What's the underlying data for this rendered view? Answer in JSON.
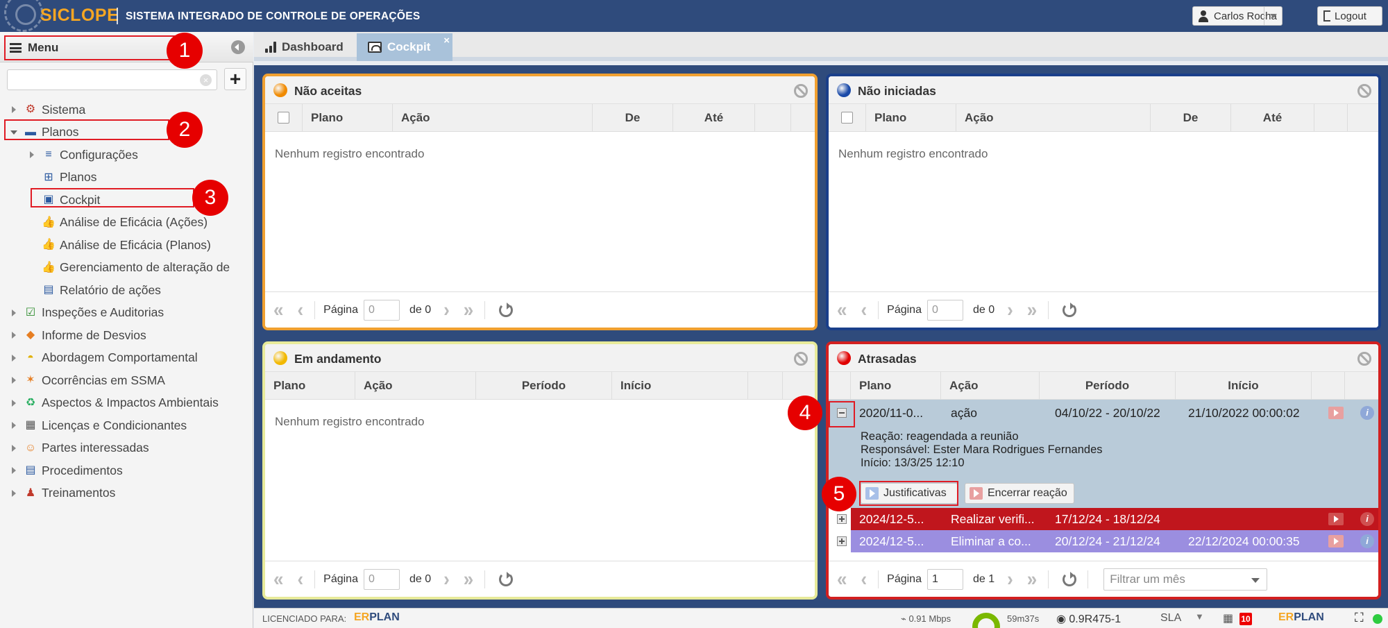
{
  "app": {
    "logo": "SICLOPE",
    "subtitle": "SISTEMA INTEGRADO DE CONTROLE DE OPERAÇÕES",
    "user_name": "Carlos Rocha",
    "logout_label": "Logout"
  },
  "sidebar": {
    "menu_title": "Menu",
    "search": {
      "value": "",
      "placeholder": ""
    },
    "add_label": "+",
    "items": [
      {
        "label": "Sistema",
        "icon": "gear-icon",
        "level": 0,
        "state": "closed"
      },
      {
        "label": "Planos",
        "icon": "folder-icon",
        "level": 0,
        "state": "open"
      },
      {
        "label": "Configurações",
        "icon": "sliders-icon",
        "level": 1,
        "state": "closed"
      },
      {
        "label": "Planos",
        "icon": "map-icon",
        "level": 1,
        "state": "leaf"
      },
      {
        "label": "Cockpit",
        "icon": "dashboard-icon",
        "level": 1,
        "state": "leaf"
      },
      {
        "label": "Análise de Eficácia (Ações)",
        "icon": "thumbs-up-icon",
        "level": 1,
        "state": "leaf"
      },
      {
        "label": "Análise de Eficácia (Planos)",
        "icon": "thumbs-up-icon",
        "level": 1,
        "state": "leaf"
      },
      {
        "label": "Gerenciamento de alteração de",
        "icon": "thumbs-up-icon",
        "level": 1,
        "state": "leaf"
      },
      {
        "label": "Relatório de ações",
        "icon": "pdf-icon",
        "level": 1,
        "state": "leaf"
      },
      {
        "label": "Inspeções e Auditorias",
        "icon": "clipboard-check-icon",
        "level": 0,
        "state": "closed"
      },
      {
        "label": "Informe de Desvios",
        "icon": "warning-diamond-icon",
        "level": 0,
        "state": "closed"
      },
      {
        "label": "Abordagem Comportamental",
        "icon": "helmet-icon",
        "level": 0,
        "state": "closed"
      },
      {
        "label": "Ocorrências em SSMA",
        "icon": "person-falling-icon",
        "level": 0,
        "state": "closed"
      },
      {
        "label": "Aspectos & Impactos Ambientais",
        "icon": "recycle-icon",
        "level": 0,
        "state": "closed"
      },
      {
        "label": "Licenças e Condicionantes",
        "icon": "license-icon",
        "level": 0,
        "state": "closed"
      },
      {
        "label": "Partes interessadas",
        "icon": "people-icon",
        "level": 0,
        "state": "closed"
      },
      {
        "label": "Procedimentos",
        "icon": "document-list-icon",
        "level": 0,
        "state": "closed"
      },
      {
        "label": "Treinamentos",
        "icon": "trainer-icon",
        "level": 0,
        "state": "closed"
      }
    ]
  },
  "tabs": [
    {
      "label": "Dashboard",
      "icon": "bar-chart-icon",
      "active": false
    },
    {
      "label": "Cockpit",
      "icon": "dashboard-icon",
      "active": true,
      "close": "×"
    }
  ],
  "panels": {
    "nao_aceitas": {
      "title": "Não aceitas",
      "dot_color": "#f08a00",
      "columns": [
        "Plano",
        "Ação",
        "De",
        "Até"
      ],
      "empty": "Nenhum registro encontrado",
      "pager": {
        "page_label": "Página",
        "page_value": "0",
        "of_label": "de 0"
      }
    },
    "nao_iniciadas": {
      "title": "Não iniciadas",
      "dot_color": "#1a4aa8",
      "columns": [
        "Plano",
        "Ação",
        "De",
        "Até"
      ],
      "empty": "Nenhum registro encontrado",
      "pager": {
        "page_label": "Página",
        "page_value": "0",
        "of_label": "de 0"
      }
    },
    "em_andamento": {
      "title": "Em andamento",
      "dot_color": "#f2b800",
      "columns": [
        "Plano",
        "Ação",
        "Período",
        "Início"
      ],
      "empty": "Nenhum registro encontrado",
      "pager": {
        "page_label": "Página",
        "page_value": "0",
        "of_label": "de 0"
      }
    },
    "atrasadas": {
      "title": "Atrasadas",
      "dot_color": "#e00000",
      "columns": [
        "Plano",
        "Ação",
        "Período",
        "Início"
      ],
      "rows": [
        {
          "plano": "2020/11-0...",
          "acao": "ação",
          "periodo": "04/10/22 - 20/10/22",
          "inicio": "21/10/2022 00:00:02",
          "expanded": true,
          "bg": "#b9cbd9",
          "fg": "#222"
        },
        {
          "plano": "2024/12-5...",
          "acao": "Realizar verifi...",
          "periodo": "17/12/24 - 18/12/24",
          "inicio": "",
          "expanded": false,
          "bg": "#c0161d",
          "fg": "#ffffff"
        },
        {
          "plano": "2024/12-5...",
          "acao": "Eliminar a co...",
          "periodo": "20/12/24 - 21/12/24",
          "inicio": "22/12/2024 00:00:35",
          "expanded": false,
          "bg": "#9b8ee0",
          "fg": "#ffffff"
        }
      ],
      "detail": {
        "reacao": "Reação: reagendada a reunião",
        "responsavel": "Responsável: Ester Mara Rodrigues Fernandes",
        "inicio": "Início: 13/3/25 12:10",
        "btn_justificativas": "Justificativas",
        "btn_encerrar": "Encerrar reação"
      },
      "pager": {
        "page_label": "Página",
        "page_value": "1",
        "of_label": "de 1",
        "filter_placeholder": "Filtrar um mês"
      }
    }
  },
  "markers": [
    "1",
    "2",
    "3",
    "4",
    "5"
  ],
  "statusbar": {
    "licensed_label": "LICENCIADO PARA:",
    "brand_e": "ER",
    "brand_rest": "PLAN",
    "speed": "0.91 Mbps",
    "session_time": "59m37s",
    "version": "0.9R475-1",
    "sla": "SLA",
    "badge": "10"
  }
}
